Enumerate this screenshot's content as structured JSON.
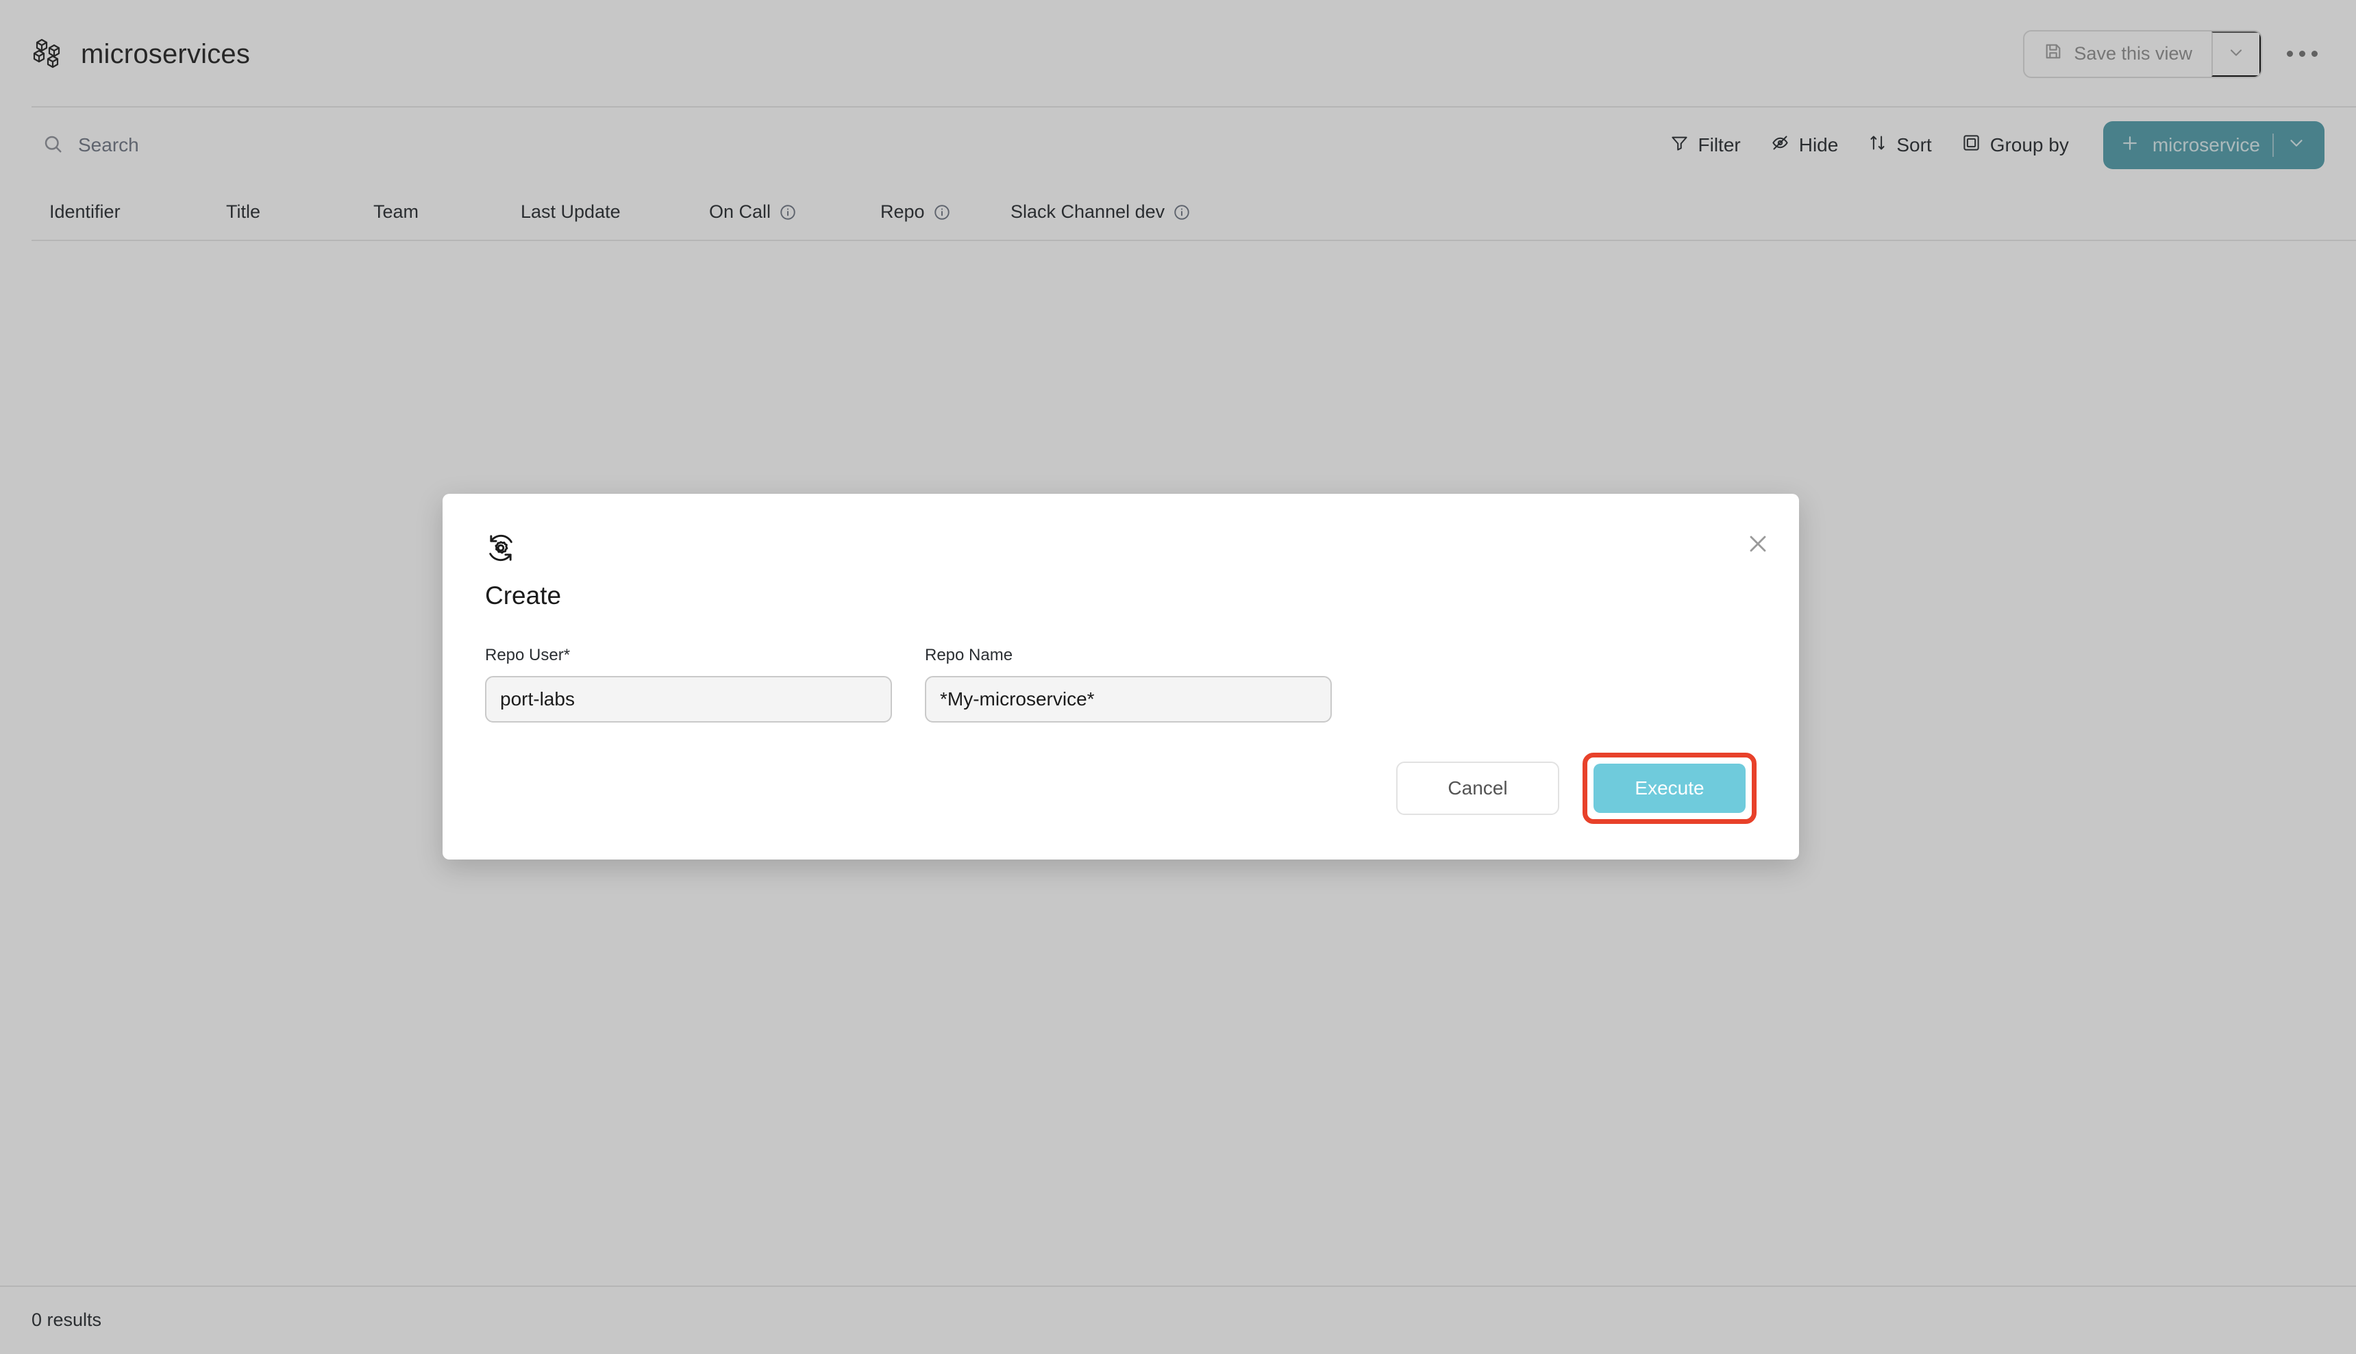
{
  "header": {
    "title": "microservices",
    "icon": "cubes-icon",
    "save_view_label": "Save this view",
    "save_view_icon": "floppy-disk-icon",
    "save_view_caret_icon": "chevron-down-icon",
    "more_menu_icon": "ellipsis-icon"
  },
  "toolbar": {
    "search_placeholder": "Search",
    "search_value": "",
    "search_icon": "search-icon",
    "actions": [
      {
        "label": "Filter",
        "icon": "filter-icon"
      },
      {
        "label": "Hide",
        "icon": "eye-off-icon"
      },
      {
        "label": "Sort",
        "icon": "sort-arrows-icon"
      },
      {
        "label": "Group by",
        "icon": "group-by-icon"
      }
    ],
    "create": {
      "label": "microservice",
      "plus_icon": "plus-icon",
      "caret_icon": "chevron-down-icon",
      "color": "#4b9aa8"
    }
  },
  "table": {
    "columns": [
      {
        "label": "Identifier",
        "info": false
      },
      {
        "label": "Title",
        "info": false
      },
      {
        "label": "Team",
        "info": false
      },
      {
        "label": "Last Update",
        "info": false
      },
      {
        "label": "On Call",
        "info": true
      },
      {
        "label": "Repo",
        "info": true
      },
      {
        "label": "Slack Channel dev",
        "info": true
      }
    ],
    "rows": [],
    "results_text": "0 results"
  },
  "modal": {
    "logo_icon": "gear-refresh-icon",
    "close_icon": "close-icon",
    "title": "Create",
    "fields": [
      {
        "label": "Repo User*",
        "value": "port-labs",
        "placeholder": "",
        "name": "repo-user"
      },
      {
        "label": "Repo Name",
        "value": "*My-microservice*",
        "placeholder": "",
        "name": "repo-name"
      }
    ],
    "cancel_label": "Cancel",
    "execute_label": "Execute",
    "execute_color": "#6fcbdc",
    "highlight_color": "#e8412a"
  }
}
